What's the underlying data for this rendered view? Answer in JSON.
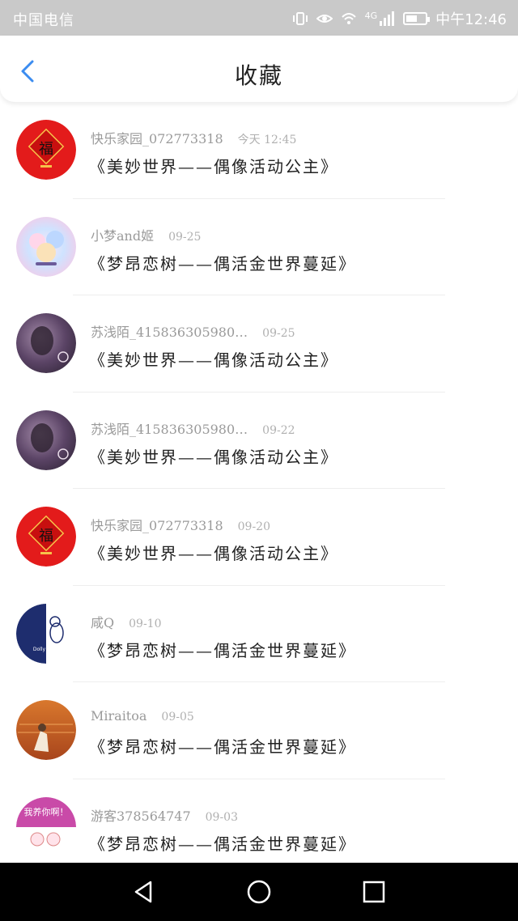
{
  "status_bar": {
    "carrier": "中国电信",
    "network": "4G",
    "time": "中午12:46",
    "battery_level": 0.6,
    "icons": [
      "vibrate-icon",
      "eye-icon",
      "wifi-icon",
      "signal-icon",
      "battery-icon"
    ]
  },
  "header": {
    "back_icon": "chevron-left-icon",
    "title": "收藏",
    "accent_color": "#3b8cf0"
  },
  "favorites": [
    {
      "user": "快乐家园_072773318",
      "date": "今天 12:45",
      "title": "《美妙世界——偶像活动公主》",
      "avatar": "fu-red"
    },
    {
      "user": "小梦and姬",
      "date": "09-25",
      "title": "《梦昂恋树——偶活金世界蔓延》",
      "avatar": "pastel-anime"
    },
    {
      "user": "苏浅陌_415836305980…",
      "date": "09-25",
      "title": "《美妙世界——偶像活动公主》",
      "avatar": "purple-girl"
    },
    {
      "user": "苏浅陌_415836305980…",
      "date": "09-22",
      "title": "《美妙世界——偶像活动公主》",
      "avatar": "purple-girl"
    },
    {
      "user": "快乐家园_072773318",
      "date": "09-20",
      "title": "《美妙世界——偶像活动公主》",
      "avatar": "fu-red"
    },
    {
      "user": "咸Q",
      "date": "09-10",
      "title": "《梦昂恋树——偶活金世界蔓延》",
      "avatar": "navy-duck"
    },
    {
      "user": "Miraitoa",
      "date": "09-05",
      "title": "《梦昂恋树——偶活金世界蔓延》",
      "avatar": "orange-sunset"
    },
    {
      "user": "游客378564747",
      "date": "09-03",
      "title": "《梦昂恋树——偶活金世界蔓延》",
      "avatar": "pink-banner"
    }
  ],
  "avatar_texts": {
    "fu": "福",
    "duck": "Dolly Duck",
    "banner": "我养你啊！"
  },
  "nav_bar": {
    "back_icon": "triangle-back-icon",
    "home_icon": "circle-home-icon",
    "recents_icon": "square-recents-icon"
  }
}
